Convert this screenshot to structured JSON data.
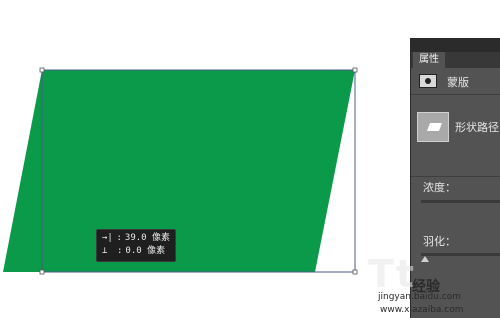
{
  "canvas": {
    "shape_fill": "#0b9a4a",
    "path_color": "#4a5b8a",
    "tooltip": {
      "width_line": "39.0 像素",
      "height_line": "0.0 像素"
    }
  },
  "properties_panel": {
    "tab_label": "属性",
    "mask_label": "蒙版",
    "shape_label": "形状路径",
    "density_label": "浓度：",
    "feather_label": "羽化："
  },
  "watermark": {
    "big_text": "Tt",
    "brand": "经验",
    "url": "jingyan.baidu.com",
    "url2": "www.xiazaiba.com"
  }
}
